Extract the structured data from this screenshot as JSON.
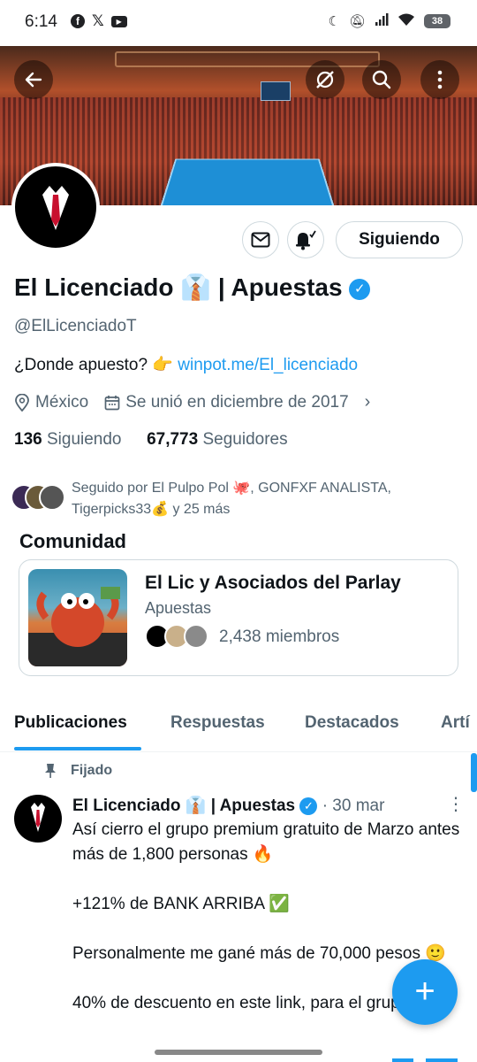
{
  "status_bar": {
    "time": "6:14",
    "left_icons": [
      "facebook-icon",
      "x-icon",
      "youtube-icon"
    ],
    "right_icons": [
      "dnd-moon-icon",
      "mute-icon",
      "signal-icon",
      "wifi-icon"
    ],
    "battery": "38"
  },
  "profile": {
    "name": "El Licenciado 👔 | Apuestas",
    "handle": "@ElLicenciadoT",
    "bio_text": "¿Donde apuesto? 👉 ",
    "bio_link": "winpot.me/El_licenciado",
    "location": "México",
    "joined": "Se unió en diciembre de 2017",
    "following_count": "136",
    "following_label": "Siguiendo",
    "followers_count": "67,773",
    "followers_label": "Seguidores",
    "followed_by": "Seguido por El Pulpo Pol 🐙, GONFXF ANALISTA, Tigerpicks33💰 y 25 más",
    "follow_button": "Siguiendo"
  },
  "community": {
    "section_title": "Comunidad",
    "name": "El Lic y Asociados del Parlay",
    "category": "Apuestas",
    "members": "2,438 miembros"
  },
  "tabs": [
    "Publicaciones",
    "Respuestas",
    "Destacados",
    "Artí"
  ],
  "post": {
    "pinned_label": "Fijado",
    "author": "El Licenciado 👔 | Apuestas",
    "date": "· 30 mar",
    "line1": "Así cierro el grupo premium gratuito de Marzo antes más de 1,800 personas 🔥",
    "line2": "+121% de BANK ARRIBA ✅",
    "line3": "Personalmente me gané más de 70,000 pesos 🙂",
    "line4": "40% de descuento en este link, para el grupo"
  },
  "colors": {
    "accent": "#1d9bf0",
    "text": "#0f1419",
    "muted": "#536471"
  }
}
